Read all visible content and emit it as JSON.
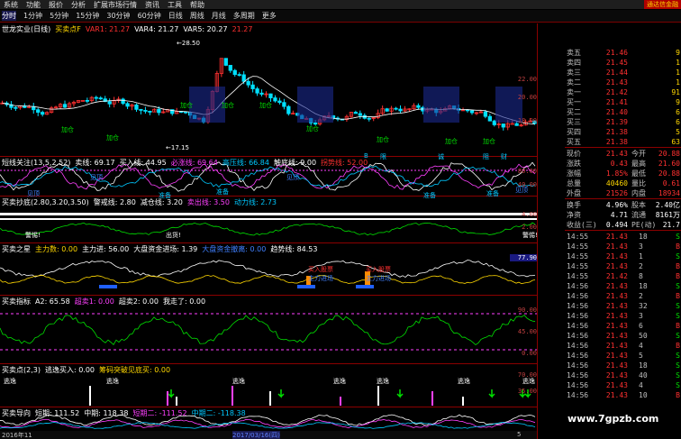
{
  "menu": [
    "系统",
    "功能",
    "报价",
    "分析",
    "扩展市场行情",
    "资讯",
    "工具",
    "帮助"
  ],
  "brand": "通达信金融",
  "periods": [
    "分时",
    "1分钟",
    "5分钟",
    "15分钟",
    "30分钟",
    "60分钟",
    "日线",
    "周线",
    "月线",
    "多周期",
    "更多"
  ],
  "panels": {
    "main": {
      "items": [
        {
          "t": "世龙实业(日线)",
          "c": "wht"
        },
        {
          "t": "买卖点F",
          "c": "yel"
        },
        {
          "t": "VAR1: 21.27",
          "c": "red"
        },
        {
          "t": "VAR4: 21.27",
          "c": "wht"
        },
        {
          "t": "VAR5: 20.27",
          "c": "wht"
        },
        {
          "t": "21.27",
          "c": "red"
        }
      ],
      "hi": "28.50",
      "lo": "17.15",
      "axis": [
        "22.00",
        "20.00",
        "18.00"
      ],
      "tags": [
        "加仓",
        "加仓",
        "加仓",
        "加仓",
        "加仓",
        "加仓",
        "加仓",
        "加仓",
        "加仓"
      ],
      "letters": [
        "B",
        "限",
        "诚",
        "阻",
        "财"
      ]
    },
    "p1": {
      "items": [
        {
          "t": "短线关注(13,5,2,52)",
          "c": "wht"
        },
        {
          "t": "卖线: 69.17",
          "c": "wht"
        },
        {
          "t": "买入线: 44.95",
          "c": "wht"
        },
        {
          "t": "必涨线: 69.64",
          "c": "mag"
        },
        {
          "t": "高压线: 66.84",
          "c": "cyn"
        },
        {
          "t": "触底线: 9.00",
          "c": "wht"
        },
        {
          "t": "拐势线: 52.00",
          "c": "red"
        }
      ],
      "axis": [
        "80.00",
        "40.00"
      ],
      "tags": [
        "见顶",
        "见顶",
        "准备",
        "准备",
        "见顶",
        "准备",
        "准备",
        "见顶"
      ]
    },
    "p2": {
      "items": [
        {
          "t": "买卖抄底(2.80,3.20,3.50)",
          "c": "wht"
        },
        {
          "t": "警戒线: 2.80",
          "c": "wht"
        },
        {
          "t": "减仓线: 3.20",
          "c": "wht"
        },
        {
          "t": "卖出线: 3.50",
          "c": "mag"
        },
        {
          "t": "动力线: 2.73",
          "c": "cyn"
        }
      ],
      "axis": [
        "4.00",
        "2.00"
      ],
      "tags": [
        "警惕!",
        "出货!",
        "警惕!"
      ]
    },
    "p3": {
      "items": [
        {
          "t": "买卖之星",
          "c": "wht"
        },
        {
          "t": "主力数: 0.00",
          "c": "yel"
        },
        {
          "t": "主力进: 56.00",
          "c": "wht"
        },
        {
          "t": "大盘资金进场: 1.39",
          "c": "wht"
        },
        {
          "t": "大盘资金撤离: 0.00",
          "c": "blu"
        },
        {
          "t": "趋势线: 84.53",
          "c": "wht"
        }
      ],
      "axis": [
        "77.90"
      ],
      "tags": [
        "买入股票",
        "买入股票",
        "主力进场",
        "主力进场"
      ]
    },
    "p4": {
      "items": [
        {
          "t": "买卖指标",
          "c": "wht"
        },
        {
          "t": "A2: 65.58",
          "c": "wht"
        },
        {
          "t": "超卖1: 0.00",
          "c": "mag"
        },
        {
          "t": "超卖2: 0.00",
          "c": "wht"
        },
        {
          "t": "我走了: 0.00",
          "c": "wht"
        }
      ],
      "axis": [
        "90.00",
        "45.00",
        "0.00"
      ]
    },
    "p5": {
      "items": [
        {
          "t": "买卖点(2,3)",
          "c": "wht"
        },
        {
          "t": "逃逸买入: 0.00",
          "c": "wht"
        },
        {
          "t": "筹码突破见底买: 0.00",
          "c": "yel"
        }
      ],
      "axis": [
        "70.00",
        "35.00"
      ],
      "tags": [
        "逃逸",
        "逃逸",
        "逃逸",
        "逃逸",
        "逃逸",
        "逃逸",
        "逃逸"
      ]
    },
    "p6": {
      "items": [
        {
          "t": "买卖导向",
          "c": "wht"
        },
        {
          "t": "短期: 111.52",
          "c": "wht"
        },
        {
          "t": "中期: 118.38",
          "c": "wht"
        },
        {
          "t": "短期二: -111.52",
          "c": "mag"
        },
        {
          "t": "中期二: -118.38",
          "c": "cyn"
        }
      ]
    }
  },
  "bottom": {
    "left": "2016年11",
    "mid": "2017/03/16(四)",
    "right": "5",
    "items": [
      "1",
      "2",
      "3",
      "4",
      "5",
      "6",
      "7",
      "8",
      "9",
      "10"
    ]
  },
  "quote": {
    "asks": [
      {
        "l": "卖五",
        "p": "21.46",
        "v": "9"
      },
      {
        "l": "卖四",
        "p": "21.45",
        "v": "1"
      },
      {
        "l": "卖三",
        "p": "21.44",
        "v": "1"
      },
      {
        "l": "卖二",
        "p": "21.43",
        "v": "1"
      },
      {
        "l": "卖一",
        "p": "21.42",
        "v": "91"
      }
    ],
    "bids": [
      {
        "l": "买一",
        "p": "21.41",
        "v": "9"
      },
      {
        "l": "买二",
        "p": "21.40",
        "v": "6"
      },
      {
        "l": "买三",
        "p": "21.39",
        "v": "6"
      },
      {
        "l": "买四",
        "p": "21.38",
        "v": "5"
      },
      {
        "l": "买五",
        "p": "21.38",
        "v": "63"
      }
    ],
    "stats": [
      {
        "l": "现价",
        "v": "21.43",
        "c": "red",
        "l2": "今开",
        "v2": "20.88"
      },
      {
        "l": "涨跌",
        "v": "0.43",
        "c": "red",
        "l2": "最高",
        "v2": "21.60"
      },
      {
        "l": "涨幅",
        "v": "1.85%",
        "c": "red",
        "l2": "最低",
        "v2": "20.88"
      },
      {
        "l": "总量",
        "v": "40460",
        "c": "yel",
        "l2": "量比",
        "v2": "0.61"
      },
      {
        "l": "外盘",
        "v": "21526",
        "c": "red",
        "l2": "内盘",
        "v2": "18934"
      }
    ],
    "stats2": [
      {
        "l": "换手",
        "v": "4.96%",
        "c": "wht",
        "l2": "股本",
        "v2": "2.40亿"
      },
      {
        "l": "净资",
        "v": "4.71",
        "c": "wht",
        "l2": "流通",
        "v2": "8161万"
      },
      {
        "l": "收益(三)",
        "v": "0.494",
        "c": "wht",
        "l2": "PE(动)",
        "v2": "21.7"
      }
    ],
    "ticks": [
      {
        "t": "14:55",
        "p": "21.43",
        "v": "18",
        "d": "S"
      },
      {
        "t": "14:55",
        "p": "21.43",
        "v": "3",
        "d": "B"
      },
      {
        "t": "14:55",
        "p": "21.43",
        "v": "1",
        "d": "S"
      },
      {
        "t": "14:55",
        "p": "21.43",
        "v": "2",
        "d": "B"
      },
      {
        "t": "14:55",
        "p": "21.42",
        "v": "8",
        "d": "B"
      },
      {
        "t": "14:56",
        "p": "21.43",
        "v": "18",
        "d": "S"
      },
      {
        "t": "14:56",
        "p": "21.43",
        "v": "2",
        "d": "B"
      },
      {
        "t": "14:56",
        "p": "21.43",
        "v": "32",
        "d": "S"
      },
      {
        "t": "14:56",
        "p": "21.43",
        "v": "3",
        "d": "S"
      },
      {
        "t": "14:56",
        "p": "21.43",
        "v": "6",
        "d": "B"
      },
      {
        "t": "14:56",
        "p": "21.43",
        "v": "50",
        "d": "S"
      },
      {
        "t": "14:56",
        "p": "21.43",
        "v": "4",
        "d": "B"
      },
      {
        "t": "14:56",
        "p": "21.43",
        "v": "5",
        "d": "S"
      },
      {
        "t": "14:56",
        "p": "21.43",
        "v": "18",
        "d": "S"
      },
      {
        "t": "14:56",
        "p": "21.43",
        "v": "40",
        "d": "S"
      },
      {
        "t": "14:56",
        "p": "21.43",
        "v": "4",
        "d": "S"
      },
      {
        "t": "14:56",
        "p": "21.43",
        "v": "10",
        "d": "B"
      }
    ]
  },
  "watermark": "www.7gpzb.com",
  "colors": {
    "up": "#ff3030",
    "down": "#00e000",
    "sep": "#8b0000"
  }
}
